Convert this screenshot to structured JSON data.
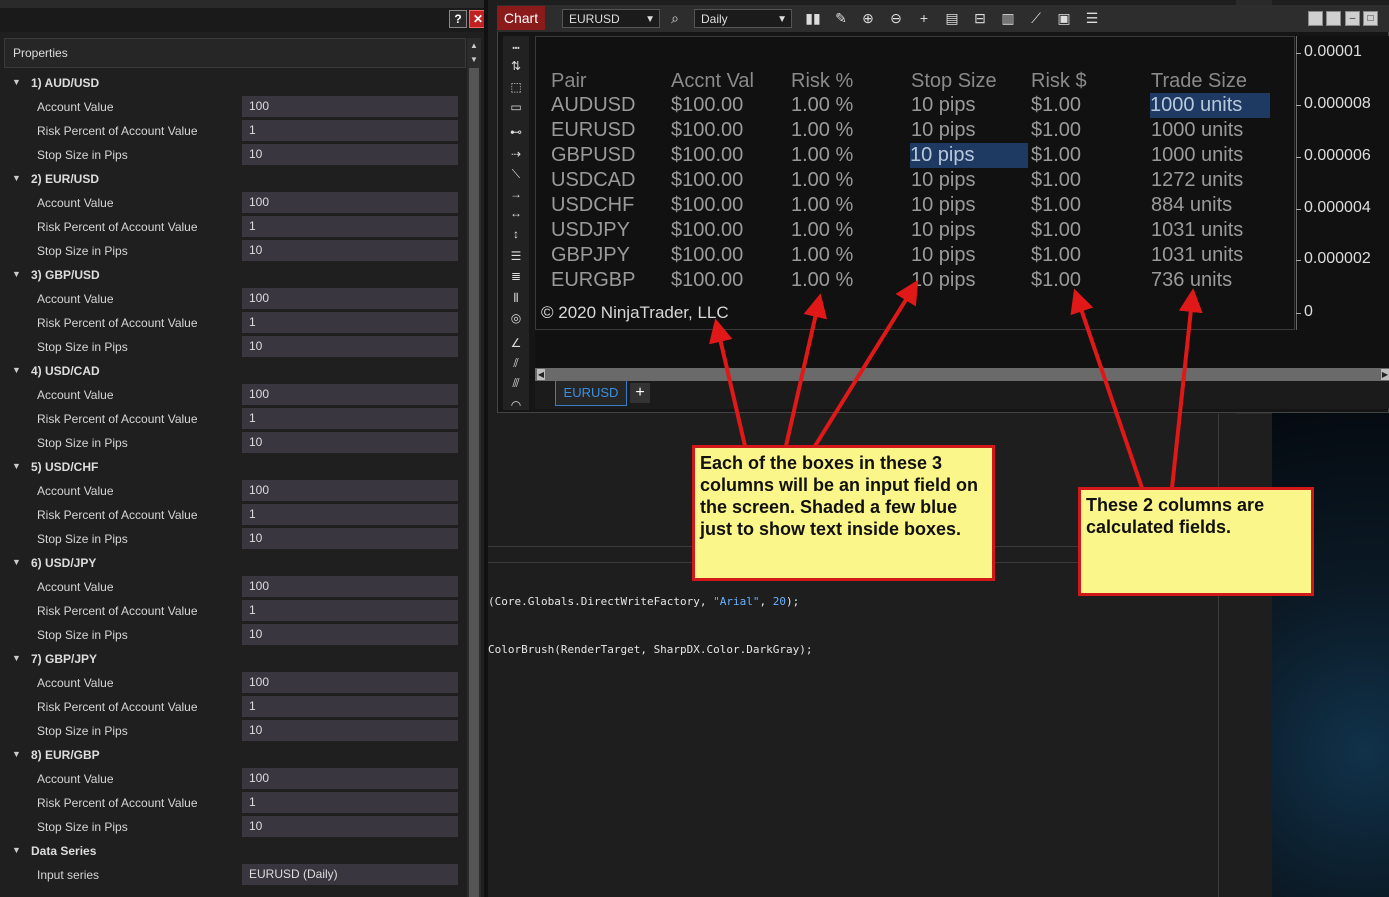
{
  "properties_panel": {
    "header": "Properties",
    "help_label": "?",
    "close_label": "✕",
    "groups": [
      {
        "title": "1) AUD/USD",
        "rows": [
          {
            "label": "Account Value",
            "value": "100"
          },
          {
            "label": "Risk Percent of Account Value",
            "value": "1"
          },
          {
            "label": "Stop Size in Pips",
            "value": "10"
          }
        ]
      },
      {
        "title": "2) EUR/USD",
        "rows": [
          {
            "label": "Account Value",
            "value": "100"
          },
          {
            "label": "Risk Percent of Account Value",
            "value": "1"
          },
          {
            "label": "Stop Size in Pips",
            "value": "10"
          }
        ]
      },
      {
        "title": "3) GBP/USD",
        "rows": [
          {
            "label": "Account Value",
            "value": "100"
          },
          {
            "label": "Risk Percent of Account Value",
            "value": "1"
          },
          {
            "label": "Stop Size in Pips",
            "value": "10"
          }
        ]
      },
      {
        "title": "4) USD/CAD",
        "rows": [
          {
            "label": "Account Value",
            "value": "100"
          },
          {
            "label": "Risk Percent of Account Value",
            "value": "1"
          },
          {
            "label": "Stop Size in Pips",
            "value": "10"
          }
        ]
      },
      {
        "title": "5) USD/CHF",
        "rows": [
          {
            "label": "Account Value",
            "value": "100"
          },
          {
            "label": "Risk Percent of Account Value",
            "value": "1"
          },
          {
            "label": "Stop Size in Pips",
            "value": "10"
          }
        ]
      },
      {
        "title": "6) USD/JPY",
        "rows": [
          {
            "label": "Account Value",
            "value": "100"
          },
          {
            "label": "Risk Percent of Account Value",
            "value": "1"
          },
          {
            "label": "Stop Size in Pips",
            "value": "10"
          }
        ]
      },
      {
        "title": "7) GBP/JPY",
        "rows": [
          {
            "label": "Account Value",
            "value": "100"
          },
          {
            "label": "Risk Percent of Account Value",
            "value": "1"
          },
          {
            "label": "Stop Size in Pips",
            "value": "10"
          }
        ]
      },
      {
        "title": "8) EUR/GBP",
        "rows": [
          {
            "label": "Account Value",
            "value": "100"
          },
          {
            "label": "Risk Percent of Account Value",
            "value": "1"
          },
          {
            "label": "Stop Size in Pips",
            "value": "10"
          }
        ]
      }
    ],
    "data_series": {
      "title": "Data Series",
      "input_label": "Input series",
      "input_value": "EURUSD (Daily)"
    }
  },
  "chart_window": {
    "tab_label": "Chart",
    "instrument": "EURUSD",
    "period": "Daily",
    "series_tab": "EURUSD",
    "add_tab": "+",
    "table": {
      "headers": [
        "Pair",
        "Accnt Val",
        "Risk %",
        "Stop Size",
        "Risk $",
        "Trade Size"
      ],
      "rows": [
        [
          "AUDUSD",
          "$100.00",
          "1.00 %",
          "10 pips",
          "$1.00",
          "1000 units"
        ],
        [
          "EURUSD",
          "$100.00",
          "1.00 %",
          "10 pips",
          "$1.00",
          "1000 units"
        ],
        [
          "GBPUSD",
          "$100.00",
          "1.00 %",
          "10 pips",
          "$1.00",
          "1000 units"
        ],
        [
          "USDCAD",
          "$100.00",
          "1.00 %",
          "10 pips",
          "$1.00",
          "1272 units"
        ],
        [
          "USDCHF",
          "$100.00",
          "1.00 %",
          "10 pips",
          "$1.00",
          "884 units"
        ],
        [
          "USDJPY",
          "$100.00",
          "1.00 %",
          "10 pips",
          "$1.00",
          "1031 units"
        ],
        [
          "GBPJPY",
          "$100.00",
          "1.00 %",
          "10 pips",
          "$1.00",
          "1031 units"
        ],
        [
          "EURGBP",
          "$100.00",
          "1.00 %",
          "10 pips",
          "$1.00",
          "736 units"
        ]
      ],
      "highlight_color": "#1f3a62"
    },
    "copyright": "© 2020 NinjaTrader, LLC",
    "y_axis_labels": [
      "0.00001",
      "0.000008",
      "0.000006",
      "0.000004",
      "0.000002",
      "0"
    ]
  },
  "editor": {
    "line1_a": "(Core.Globals.DirectWriteFactory, ",
    "line1_str": "\"Arial\"",
    "line1_b": ", ",
    "line1_num": "20",
    "line1_c": ");",
    "line2": "ColorBrush(RenderTarget, SharpDX.Color.DarkGray);"
  },
  "annotations": {
    "callout_inputs": "Each of the boxes in these 3 columns will be an input field on the screen.  Shaded a few blue just to show text inside boxes.",
    "callout_calc": "These 2 columns are calculated fields.",
    "border_color": "#d21818",
    "fill_color": "#fbf68a"
  },
  "icons": [
    "help-icon",
    "close-icon",
    "search-icon",
    "bar-chart-icon",
    "pencil-icon",
    "zoom-in-icon",
    "zoom-out-icon",
    "crosshair-icon",
    "properties-icon",
    "strategy-icon",
    "indicator-icon",
    "line-icon",
    "template-icon",
    "list-icon"
  ]
}
